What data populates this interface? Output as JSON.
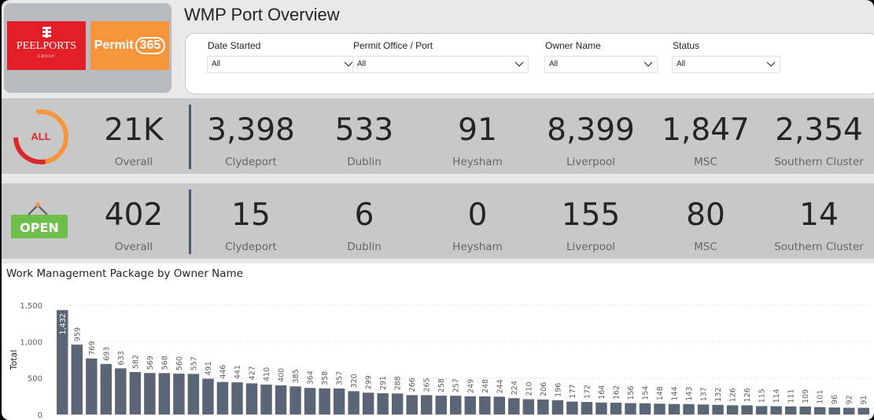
{
  "header": {
    "title": "WMP Port Overview",
    "logo_peel": {
      "name": "PEELPORTS",
      "sub": "GROUP"
    },
    "logo_permit": {
      "text": "Permit",
      "num": "365"
    }
  },
  "filters": [
    {
      "label": "Date Started",
      "value": "All"
    },
    {
      "label": "Permit Office / Port",
      "value": "All"
    },
    {
      "label": "Owner Name",
      "value": "All"
    },
    {
      "label": "Status",
      "value": "All"
    }
  ],
  "kpi_all": {
    "badge": "ALL",
    "items": [
      {
        "value": "21K",
        "label": "Overall"
      },
      {
        "value": "3,398",
        "label": "Clydeport"
      },
      {
        "value": "533",
        "label": "Dublin"
      },
      {
        "value": "91",
        "label": "Heysham"
      },
      {
        "value": "8,399",
        "label": "Liverpool"
      },
      {
        "value": "1,847",
        "label": "MSC"
      },
      {
        "value": "2,354",
        "label": "Southern Cluster"
      }
    ]
  },
  "kpi_open": {
    "badge": "OPEN",
    "items": [
      {
        "value": "402",
        "label": "Overall"
      },
      {
        "value": "15",
        "label": "Clydeport"
      },
      {
        "value": "6",
        "label": "Dublin"
      },
      {
        "value": "0",
        "label": "Heysham"
      },
      {
        "value": "155",
        "label": "Liverpool"
      },
      {
        "value": "80",
        "label": "MSC"
      },
      {
        "value": "14",
        "label": "Southern Cluster"
      }
    ]
  },
  "colors": {
    "bar": "#5a6676",
    "all_ring_orange": "#f6953b",
    "all_ring_red": "#d9272e",
    "open_sign": "#6cc04a"
  },
  "chart_data": {
    "type": "bar",
    "title": "Work Management Package by Owner Name",
    "ylabel": "Total",
    "xlabel": "",
    "ylim": [
      0,
      1500
    ],
    "yticks": [
      0,
      500,
      1000,
      1500
    ],
    "ytick_labels": [
      "0",
      "500",
      "1,000",
      "1,500"
    ],
    "grid": true,
    "values": [
      1432,
      959,
      769,
      693,
      633,
      582,
      569,
      568,
      560,
      557,
      491,
      446,
      441,
      427,
      410,
      400,
      385,
      364,
      358,
      357,
      320,
      299,
      291,
      288,
      266,
      265,
      258,
      257,
      249,
      248,
      244,
      224,
      210,
      206,
      196,
      177,
      172,
      164,
      162,
      156,
      154,
      148,
      144,
      143,
      137,
      132,
      126,
      126,
      115,
      114,
      111,
      109,
      101,
      96,
      92,
      91
    ]
  }
}
